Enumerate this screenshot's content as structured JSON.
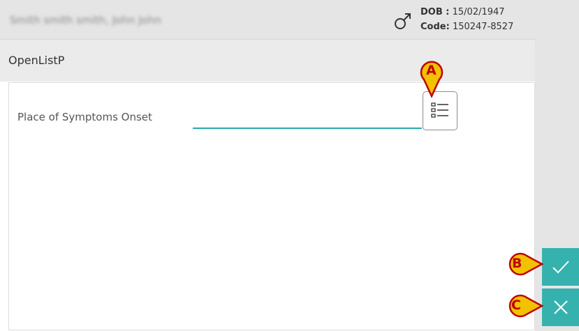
{
  "header": {
    "patient_name": "Smith smith smith, John John",
    "dob_label": "DOB :",
    "dob_value": "15/02/1947",
    "code_label": "Code:",
    "code_value": "150247-8527",
    "gender_icon": "male-icon"
  },
  "title": "OpenListP",
  "form": {
    "field_label": "Place of Symptoms Onset",
    "field_value": "",
    "list_button_icon": "list-icon"
  },
  "actions": {
    "confirm_icon": "checkmark-icon",
    "cancel_icon": "close-icon"
  },
  "callouts": [
    "A",
    "B",
    "C"
  ],
  "colors": {
    "accent": "#35b2ae",
    "input_underline": "#26aab0",
    "callout_fill": "#f2c200",
    "callout_border": "#c00000"
  }
}
